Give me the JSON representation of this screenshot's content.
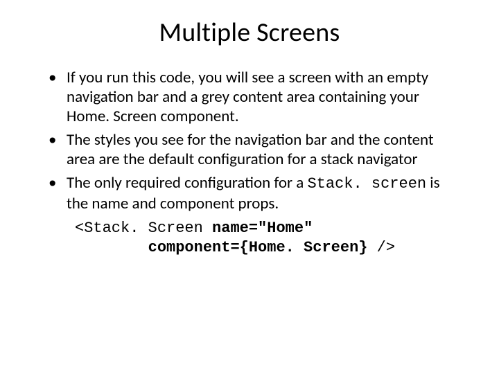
{
  "title": "Multiple Screens",
  "bullets": [
    {
      "text": "If you run this code, you will see a screen with an empty navigation bar and a grey content area containing your Home. Screen component."
    },
    {
      "text": "The styles you see for the navigation bar and the content area are the default configuration for a stack navigator"
    },
    {
      "prefix": "The only required configuration for a ",
      "mono": "Stack. screen",
      "suffix": " is the name and component props."
    }
  ],
  "code": {
    "line1_pre": "<Stack. Screen ",
    "line1_bold": "name=\"Home\"",
    "line2_indent": "        ",
    "line2_bold": "component={Home. Screen}",
    "line2_post": " />"
  }
}
